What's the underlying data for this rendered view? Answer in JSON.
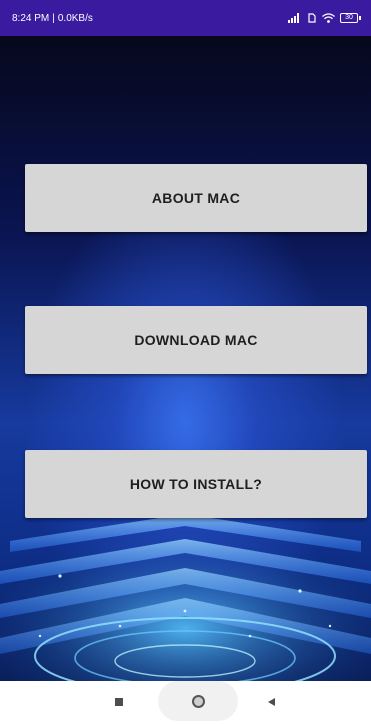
{
  "status_bar": {
    "time": "8:24 PM",
    "separator": "|",
    "network_speed": "0.0KB/s",
    "battery": "30",
    "icons": [
      "signal-icon",
      "sim-icon",
      "wifi-icon",
      "battery-icon"
    ]
  },
  "buttons": {
    "about_label": "ABOUT MAC",
    "download_label": "DOWNLOAD MAC",
    "install_label": "HOW TO INSTALL?"
  },
  "nav_bar": {
    "icons": [
      "recents-icon",
      "home-icon",
      "back-icon"
    ]
  },
  "colors": {
    "status_bar_bg": "#3a1ba0",
    "button_bg": "#d6d6d6",
    "button_text": "#1f1f1f",
    "background_top": "#06081c",
    "background_glow": "#376eeb"
  }
}
